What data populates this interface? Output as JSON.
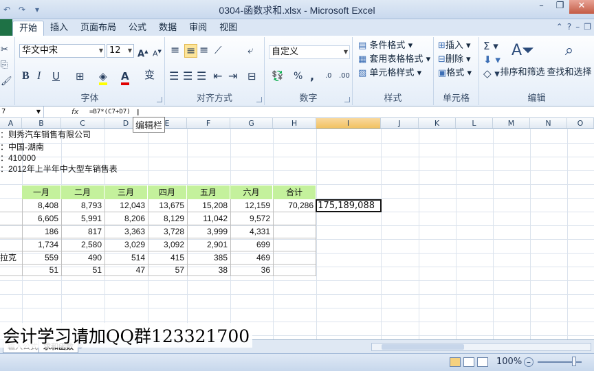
{
  "window": {
    "title": "0304-函数求和.xlsx - Microsoft Excel"
  },
  "tabs": [
    "开始",
    "插入",
    "页面布局",
    "公式",
    "数据",
    "审阅",
    "视图"
  ],
  "ribbon": {
    "font_name": "华文中宋",
    "font_size": "12",
    "number_format": "自定义",
    "groups": {
      "font": "字体",
      "align": "对齐方式",
      "number": "数字",
      "styles": "样式",
      "cells": "单元格",
      "edit": "编辑"
    },
    "styles_buttons": [
      "条件格式",
      "套用表格格式",
      "单元格样式"
    ],
    "cells_buttons": [
      "插入",
      "删除",
      "格式"
    ],
    "sort_filter": "排序和筛选",
    "find_select": "查找和选择"
  },
  "formula_bar": {
    "name_box": "7",
    "fx": "fx",
    "formula": "=B7*(C7+D7)",
    "tooltip": "编辑栏"
  },
  "columns": [
    "A",
    "B",
    "C",
    "D",
    "E",
    "F",
    "G",
    "H",
    "I",
    "J",
    "K",
    "L",
    "M",
    "N",
    "O"
  ],
  "info_lines": [
    "：则秀汽车销售有限公司",
    "：中国-湖南",
    "：410000",
    "：2012年上半年中大型车销售表"
  ],
  "table": {
    "headers": [
      "一月",
      "二月",
      "三月",
      "四月",
      "五月",
      "六月",
      "合计"
    ],
    "row_labels": [
      "",
      "",
      "",
      "",
      "拉克",
      ""
    ],
    "rows": [
      [
        "8,408",
        "8,793",
        "12,043",
        "13,675",
        "15,208",
        "12,159",
        "70,286"
      ],
      [
        "6,605",
        "5,991",
        "8,206",
        "8,129",
        "11,042",
        "9,572",
        ""
      ],
      [
        "186",
        "817",
        "3,363",
        "3,728",
        "3,999",
        "4,331",
        ""
      ],
      [
        "1,734",
        "2,580",
        "3,029",
        "3,092",
        "2,901",
        "699",
        ""
      ],
      [
        "559",
        "490",
        "514",
        "415",
        "385",
        "469",
        ""
      ],
      [
        "51",
        "51",
        "47",
        "57",
        "38",
        "36",
        ""
      ]
    ]
  },
  "active_cell": {
    "value": "175,189,088"
  },
  "watermark": "会计学习请加QQ群123321700",
  "sheet_tabs": [
    "输入公式",
    "求和函数"
  ],
  "status": {
    "zoom": "100%"
  }
}
